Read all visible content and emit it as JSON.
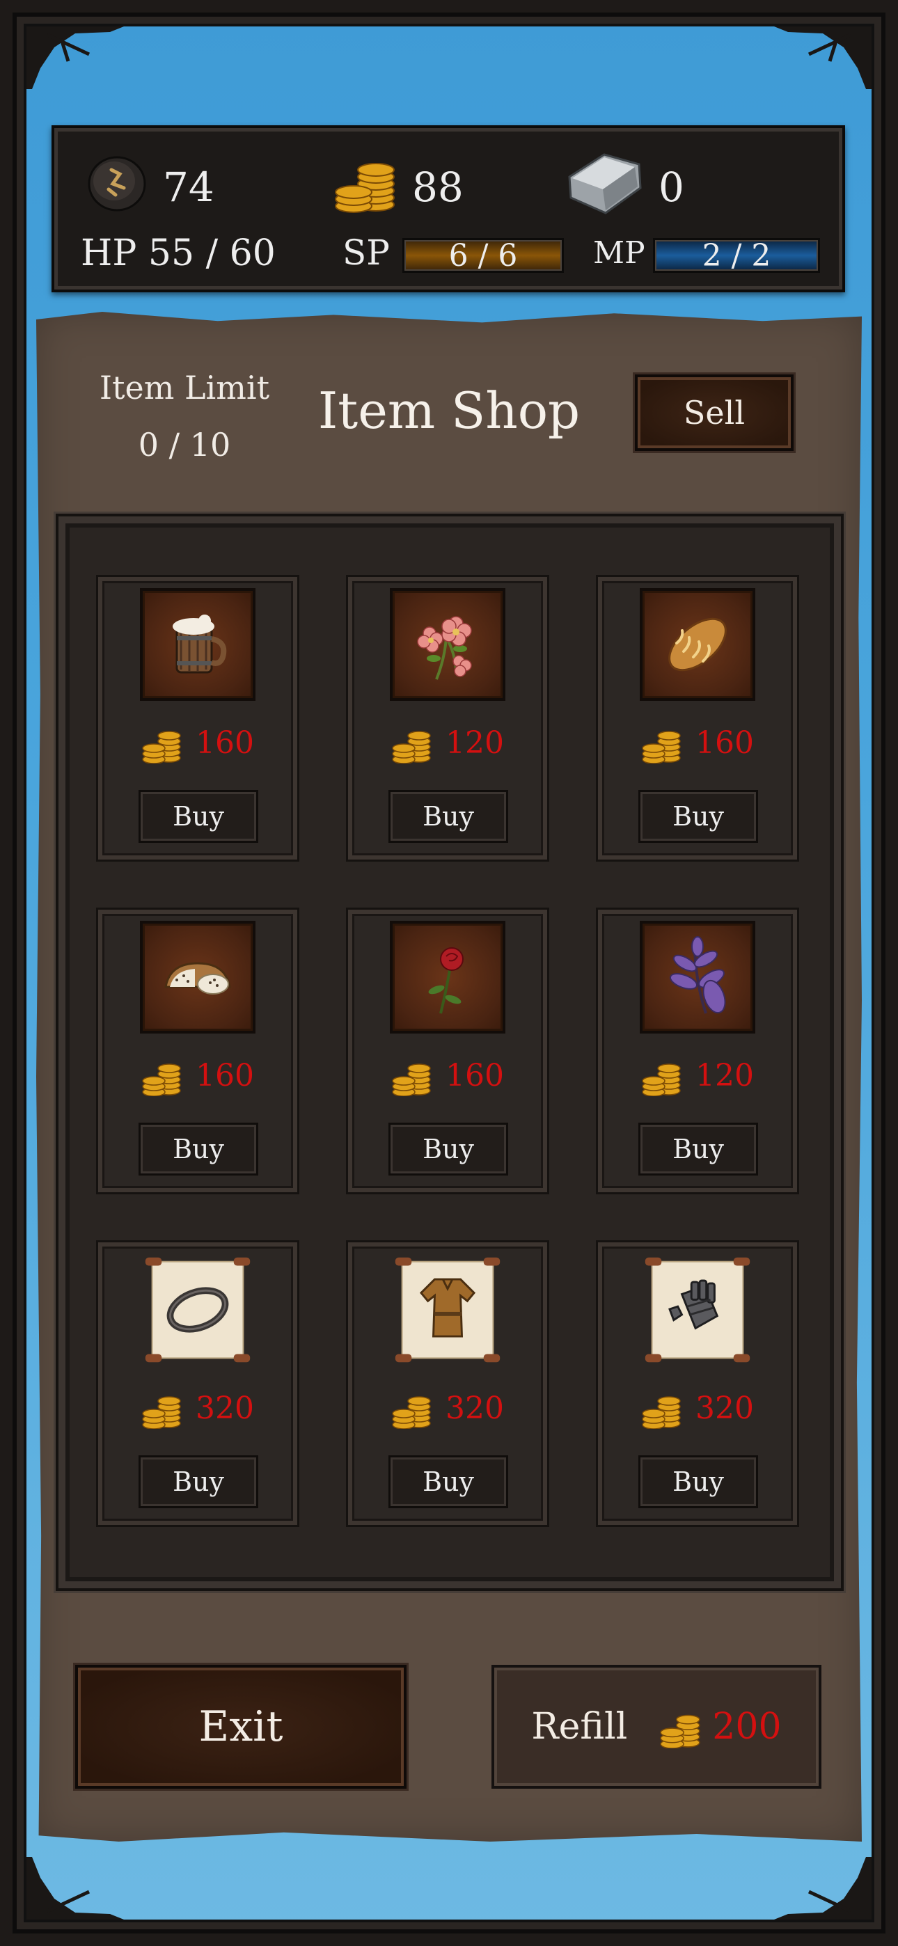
{
  "stats": {
    "rune_count": "74",
    "gold": "88",
    "silver": "0",
    "hp_text": "HP 55 / 60",
    "sp_label": "SP",
    "sp_value": "6 / 6",
    "sp_fill": 1.0,
    "mp_label": "MP",
    "mp_value": "2 / 2",
    "mp_fill": 1.0,
    "icons": [
      "rune-stone-icon",
      "gold-coins-icon",
      "silver-ingot-icon"
    ]
  },
  "shop": {
    "limit_label": "Item Limit",
    "limit_value": "0 / 10",
    "title": "Item Shop",
    "sell_label": "Sell",
    "items": [
      {
        "icon": "ale-mug-icon",
        "price": "160",
        "buy": "Buy"
      },
      {
        "icon": "pink-flower-icon",
        "price": "120",
        "buy": "Buy"
      },
      {
        "icon": "bread-loaf-icon",
        "price": "160",
        "buy": "Buy"
      },
      {
        "icon": "cheese-bread-icon",
        "price": "160",
        "buy": "Buy"
      },
      {
        "icon": "red-rose-icon",
        "price": "160",
        "buy": "Buy"
      },
      {
        "icon": "purple-herb-icon",
        "price": "120",
        "buy": "Buy"
      },
      {
        "icon": "ring-scroll-icon",
        "price": "320",
        "buy": "Buy"
      },
      {
        "icon": "tunic-scroll-icon",
        "price": "320",
        "buy": "Buy"
      },
      {
        "icon": "gauntlet-scroll-icon",
        "price": "320",
        "buy": "Buy"
      }
    ]
  },
  "footer": {
    "exit_label": "Exit",
    "refill_label": "Refill",
    "refill_price": "200"
  },
  "colors": {
    "price_red": "#d41010",
    "sky_blue": "#4aa5dc",
    "panel_brown": "#5b4c41"
  }
}
